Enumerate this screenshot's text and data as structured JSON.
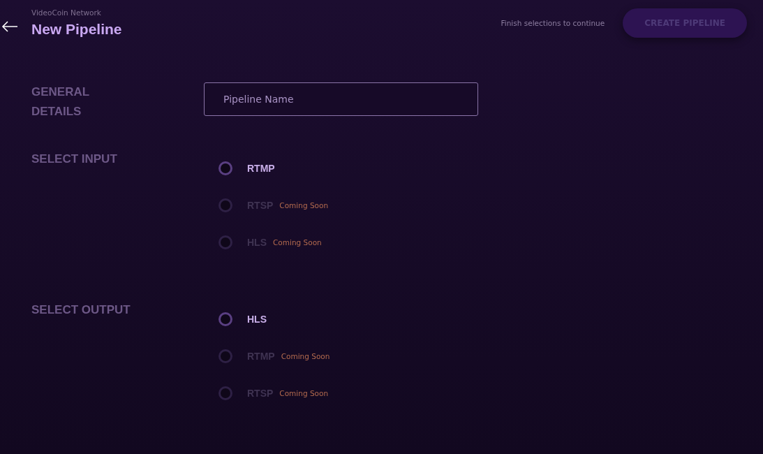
{
  "header": {
    "breadcrumb": "VideoCoin Network",
    "title": "New Pipeline",
    "hint": "Finish selections to continue",
    "create_button": {
      "label": "CREATE PIPELINE",
      "disabled": true
    }
  },
  "sections": [
    {
      "title": "GENERAL DETAILS",
      "kind": "field",
      "field": {
        "placeholder": "Pipeline Name"
      }
    },
    {
      "title": "SELECT INPUT",
      "kind": "radio",
      "options": [
        {
          "label": "RTMP",
          "selected": false,
          "disabled": false
        },
        {
          "label": "RTSP",
          "selected": false,
          "disabled": true,
          "note": "Coming Soon"
        },
        {
          "label": "HLS",
          "selected": false,
          "disabled": true,
          "note": "Coming Soon"
        }
      ]
    },
    {
      "title": "SELECT OUTPUT",
      "kind": "radio",
      "options": [
        {
          "label": "HLS",
          "selected": false,
          "disabled": false
        },
        {
          "label": "RTMP",
          "selected": false,
          "disabled": true,
          "note": "Coming Soon"
        },
        {
          "label": "RTSP",
          "selected": false,
          "disabled": true,
          "note": "Coming Soon"
        }
      ]
    }
  ]
}
